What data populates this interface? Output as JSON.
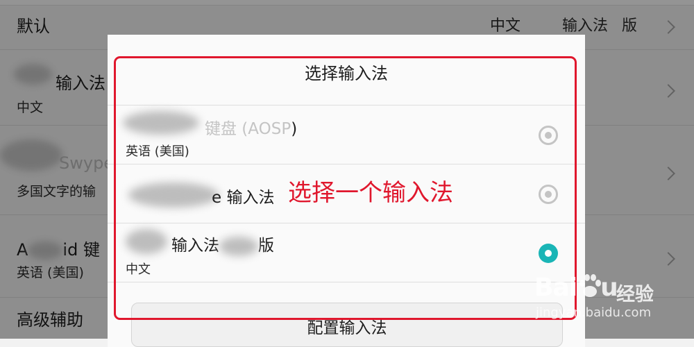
{
  "settings": {
    "rows": [
      {
        "title": "默认",
        "value": "中文",
        "value_tail": "输入法",
        "value_end": "版"
      },
      {
        "title": "输入法",
        "subtitle": "中文"
      },
      {
        "title": "Swype",
        "subtitle": "多国文字的输"
      },
      {
        "title": "A",
        "title_tail": "id 键",
        "subtitle": "英语 (美国)"
      },
      {
        "title": "高级辅助"
      }
    ]
  },
  "dialog": {
    "title": "选择输入法",
    "options": [
      {
        "name_visible": "键盘 (AOSP",
        "name_tail": ")",
        "subtitle": "英语 (美国)",
        "selected": false
      },
      {
        "name_visible": "e 输入法",
        "selected": false
      },
      {
        "name_visible": "输入法",
        "name_tail": "版",
        "subtitle": "中文",
        "selected": true
      }
    ],
    "config_button": "配置输入法"
  },
  "annotation": {
    "text": "选择一个输入法",
    "color": "#e0172d"
  },
  "accent_color": "#1ab5b6",
  "watermark": {
    "brand": "Bai",
    "brand_tail": "u",
    "product": "经验",
    "url": "jingyan.baidu.com"
  },
  "icons": [
    "chevron-right-icon",
    "radio-unselected-icon",
    "radio-selected-icon",
    "baidu-paw-icon"
  ]
}
